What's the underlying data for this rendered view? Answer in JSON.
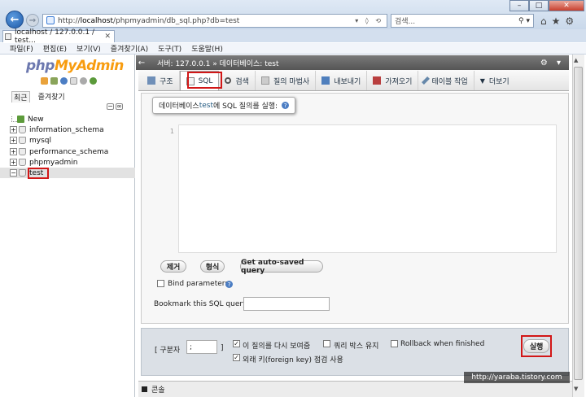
{
  "browser": {
    "url_prefix": "http://",
    "url_host": "localhost",
    "url_path": "/phpmyadmin/db_sql.php?db=test",
    "address_tools": "▾ ◊ ⟲",
    "search_placeholder": "검색...",
    "tab_title": "localhost / 127.0.0.1 / test...",
    "menu": [
      "파일(F)",
      "편집(E)",
      "보기(V)",
      "즐겨찾기(A)",
      "도구(T)",
      "도움말(H)"
    ]
  },
  "nav": {
    "logo_php": "php",
    "logo_myadmin": "MyAdmin",
    "tabs": [
      "최근",
      "즐겨찾기"
    ],
    "tree": [
      {
        "label": "New",
        "expander": ""
      },
      {
        "label": "information_schema",
        "expander": "+"
      },
      {
        "label": "mysql",
        "expander": "+"
      },
      {
        "label": "performance_schema",
        "expander": "+"
      },
      {
        "label": "phpmyadmin",
        "expander": "+"
      },
      {
        "label": "test",
        "expander": "−"
      }
    ]
  },
  "main": {
    "breadcrumb": "서버: 127.0.0.1 » 데이터베이스: test",
    "tabs": [
      {
        "label": "구조"
      },
      {
        "label": "SQL"
      },
      {
        "label": "검색"
      },
      {
        "label": "질의 마법사"
      },
      {
        "label": "내보내기"
      },
      {
        "label": "가져오기"
      },
      {
        "label": "테이블 작업"
      },
      {
        "label": "더보기"
      }
    ],
    "legend_prefix": "데이터베이스 ",
    "legend_db": "test",
    "legend_suffix": "에 SQL 질의를 실행:",
    "line_number": "1",
    "buttons": {
      "clear": "제거",
      "format": "형식",
      "autosave": "Get auto-saved query"
    },
    "bind_params_label": "Bind parameters",
    "bookmark_label": "Bookmark this SQL query:",
    "delimiter_label": "[ 구분자",
    "delimiter_value": ";",
    "closing_bracket": "]",
    "options": {
      "show_again": "이 질의를 다시 보여줌",
      "keep_box": "쿼리 박스 유지",
      "rollback": "Rollback when finished",
      "fk_check": "외래 키(foreign key) 점검 사용"
    },
    "go_button": "실행",
    "console_label": "콘솔"
  },
  "watermark": "http://yaraba.tistory.com"
}
